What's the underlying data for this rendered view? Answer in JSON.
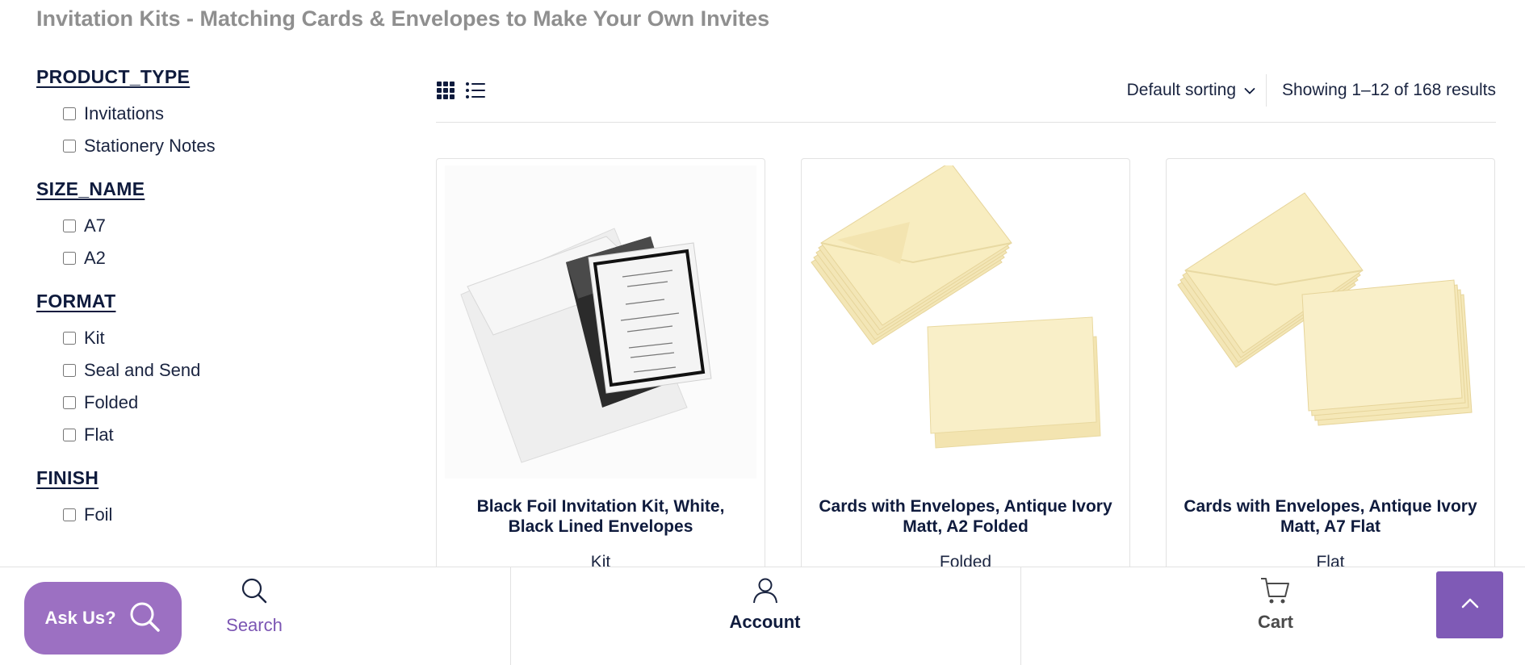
{
  "page": {
    "title": "Invitation Kits - Matching Cards & Envelopes to Make Your Own Invites"
  },
  "filters": [
    {
      "heading": "PRODUCT_TYPE",
      "options": [
        "Invitations",
        "Stationery Notes"
      ]
    },
    {
      "heading": "SIZE_NAME",
      "options": [
        "A7",
        "A2"
      ]
    },
    {
      "heading": "FORMAT",
      "options": [
        "Kit",
        "Seal and Send",
        "Folded",
        "Flat"
      ]
    },
    {
      "heading": "FINISH",
      "options": [
        "Foil"
      ]
    }
  ],
  "toolbar": {
    "grid_view_icon": "grid-icon",
    "list_view_icon": "list-icon",
    "sort_label": "Default sorting",
    "result_count": "Showing 1–12 of 168 results"
  },
  "products": [
    {
      "name": "Black Foil Invitation Kit, White, Black Lined Envelopes",
      "format": "Kit"
    },
    {
      "name": "Cards with Envelopes, Antique Ivory Matt, A2 Folded",
      "format": "Folded"
    },
    {
      "name": "Cards with Envelopes, Antique Ivory Matt, A7 Flat",
      "format": "Flat"
    }
  ],
  "bottom_bar": {
    "ask_us_label": "Ask Us?",
    "search_label": "Search",
    "account_label": "Account",
    "cart_label": "Cart",
    "back_to_top_icon": "chevron-up-icon"
  },
  "colors": {
    "navy_text": "#0f1b3d",
    "title_grey": "#8f8f8f",
    "ask_us_purple": "#9c70c2",
    "search_purple": "#7b55b3",
    "back_to_top_purple": "#7f5ab6",
    "ivory_paper": "#f8edc0"
  }
}
